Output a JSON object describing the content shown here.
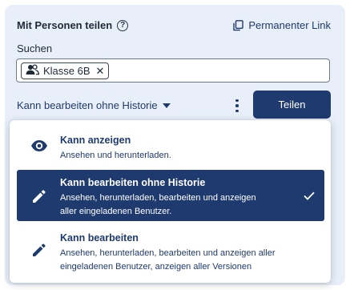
{
  "header": {
    "title": "Mit Personen teilen",
    "help_icon": "?",
    "permanent_link_label": "Permanenter Link"
  },
  "search": {
    "label": "Suchen",
    "chips": [
      {
        "label": "Klasse 6B"
      }
    ],
    "remove_symbol": "✕"
  },
  "permission": {
    "selected_label": "Kann bearbeiten ohne Historie"
  },
  "actions": {
    "share_label": "Teilen"
  },
  "dropdown": {
    "options": [
      {
        "title": "Kann anzeigen",
        "desc_line1": "Ansehen und herunterladen.",
        "desc_line2": "",
        "icon": "eye-icon",
        "selected": false
      },
      {
        "title": "Kann bearbeiten ohne Historie",
        "desc_line1": "Ansehen, herunterladen, bearbeiten und anzeigen",
        "desc_line2": "aller eingeladenen Benutzer.",
        "icon": "pencil-icon",
        "selected": true
      },
      {
        "title": "Kann bearbeiten",
        "desc_line1": "Ansehen, herunterladen, bearbeiten und anzeigen aller",
        "desc_line2": "eingeladenen Benutzer, anzeigen aller Versionen",
        "icon": "pencil-icon",
        "selected": false
      }
    ]
  },
  "colors": {
    "primary": "#1e3a6e",
    "panel_bg": "#e8eff8",
    "text": "#1f2a37"
  }
}
